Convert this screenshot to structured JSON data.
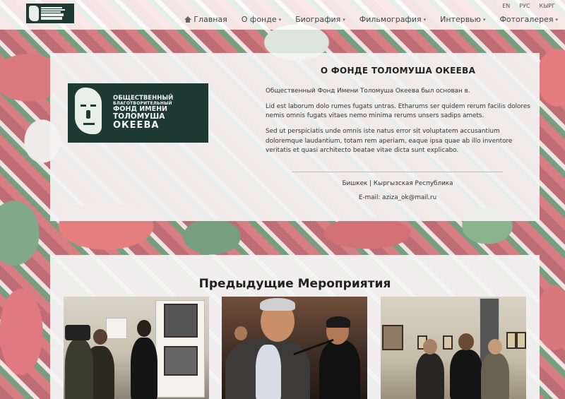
{
  "nav": {
    "languages": [
      "EN",
      "РУС",
      "КЫРГ"
    ],
    "menu": [
      {
        "label": "Главная",
        "icon": "home-icon",
        "dropdown": false
      },
      {
        "label": "О фонде",
        "dropdown": true
      },
      {
        "label": "Биография",
        "dropdown": true
      },
      {
        "label": "Фильмография",
        "dropdown": true
      },
      {
        "label": "Интервью",
        "dropdown": true
      },
      {
        "label": "Фотогалерея",
        "dropdown": true
      }
    ]
  },
  "logo": {
    "line1": "ОБЩЕСТВЕННЫЙ",
    "line2": "БЛАГОТВОРИТЕЛЬНЫЙ",
    "line3": "ФОНД ИМЕНИ",
    "line4": "ТОЛОМУША",
    "line5": "ОКЕЕВА"
  },
  "about": {
    "title_prefix": "О ФОНДЕ",
    "title_bold": "ТОЛОМУША ОКЕЕВА",
    "paragraphs": [
      "Общественный Фонд Имени Толомуша Океева был основан в.",
      "Lid est laborum dolo rumes fugats untras. Etharums ser quidem rerum facilis dolores nemis omnis fugats vitaes nemo minima rerums unsers sadips amets.",
      "Sed ut perspiciatis unde omnis iste natus error sit voluptatem accusantium doloremque laudantium, totam rem aperiam, eaque ipsa quae ab illo inventore veritatis et quasi architecto beatae vitae dicta sunt explicabo."
    ],
    "city": "Бишкек | Кыргызская Республика",
    "email": "E-mail: aziza_ok@mail.ru"
  },
  "events": {
    "title_prefix": "Предыдущие",
    "title_bold": "Мероприятия"
  },
  "colors": {
    "logo_bg": "#1f3a33",
    "divider": "#e3c23a"
  }
}
